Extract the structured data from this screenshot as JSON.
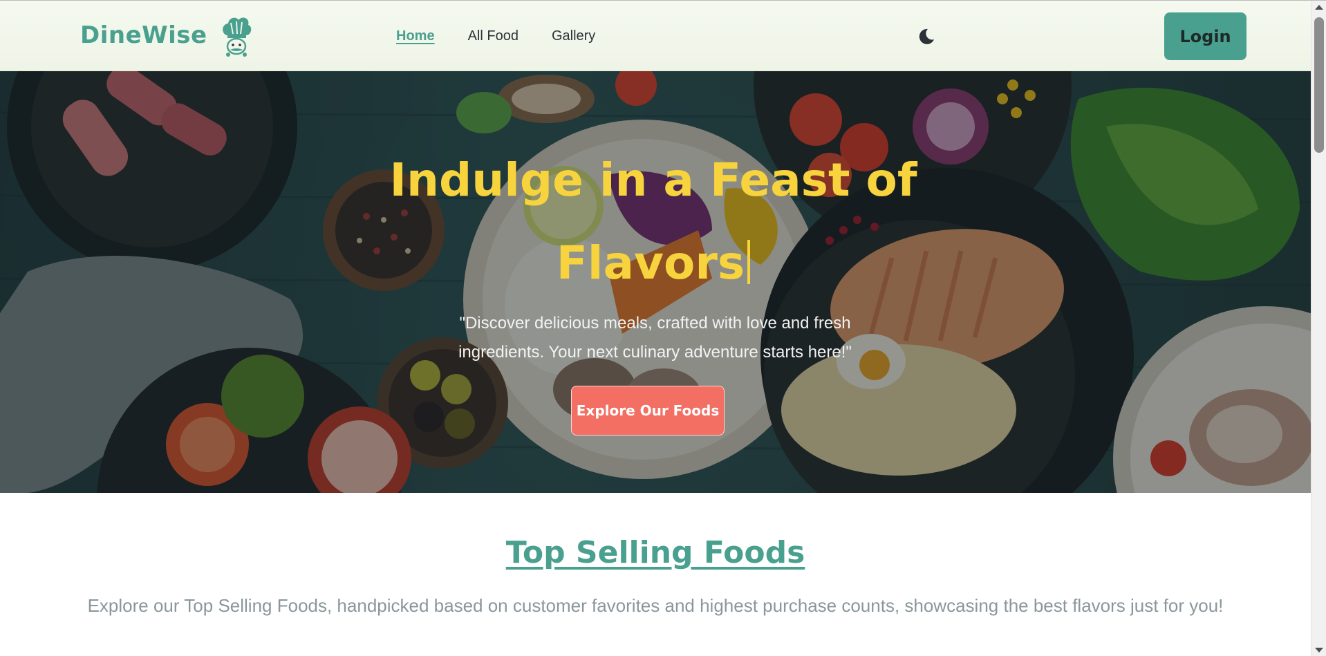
{
  "navbar": {
    "brand": "DineWise",
    "links": [
      {
        "label": "Home",
        "active": true
      },
      {
        "label": "All Food",
        "active": false
      },
      {
        "label": "Gallery",
        "active": false
      }
    ],
    "login_label": "Login"
  },
  "hero": {
    "title": "Indulge in a Feast of Flavors",
    "subtitle": "\"Discover delicious meals, crafted with love and fresh ingredients. Your next culinary adventure starts here!\"",
    "cta_label": "Explore Our Foods"
  },
  "top_selling": {
    "title": "Top Selling Foods",
    "description": "Explore our Top Selling Foods, handpicked based on customer favorites and highest purchase counts, showcasing the best flavors just for you!"
  },
  "icons": {
    "logo": "chef-hat-icon",
    "theme": "moon-icon"
  },
  "colors": {
    "brand": "#4aa08f",
    "hero_title": "#f7d33d",
    "cta": "#f36e63",
    "muted_text": "#8b969b"
  }
}
